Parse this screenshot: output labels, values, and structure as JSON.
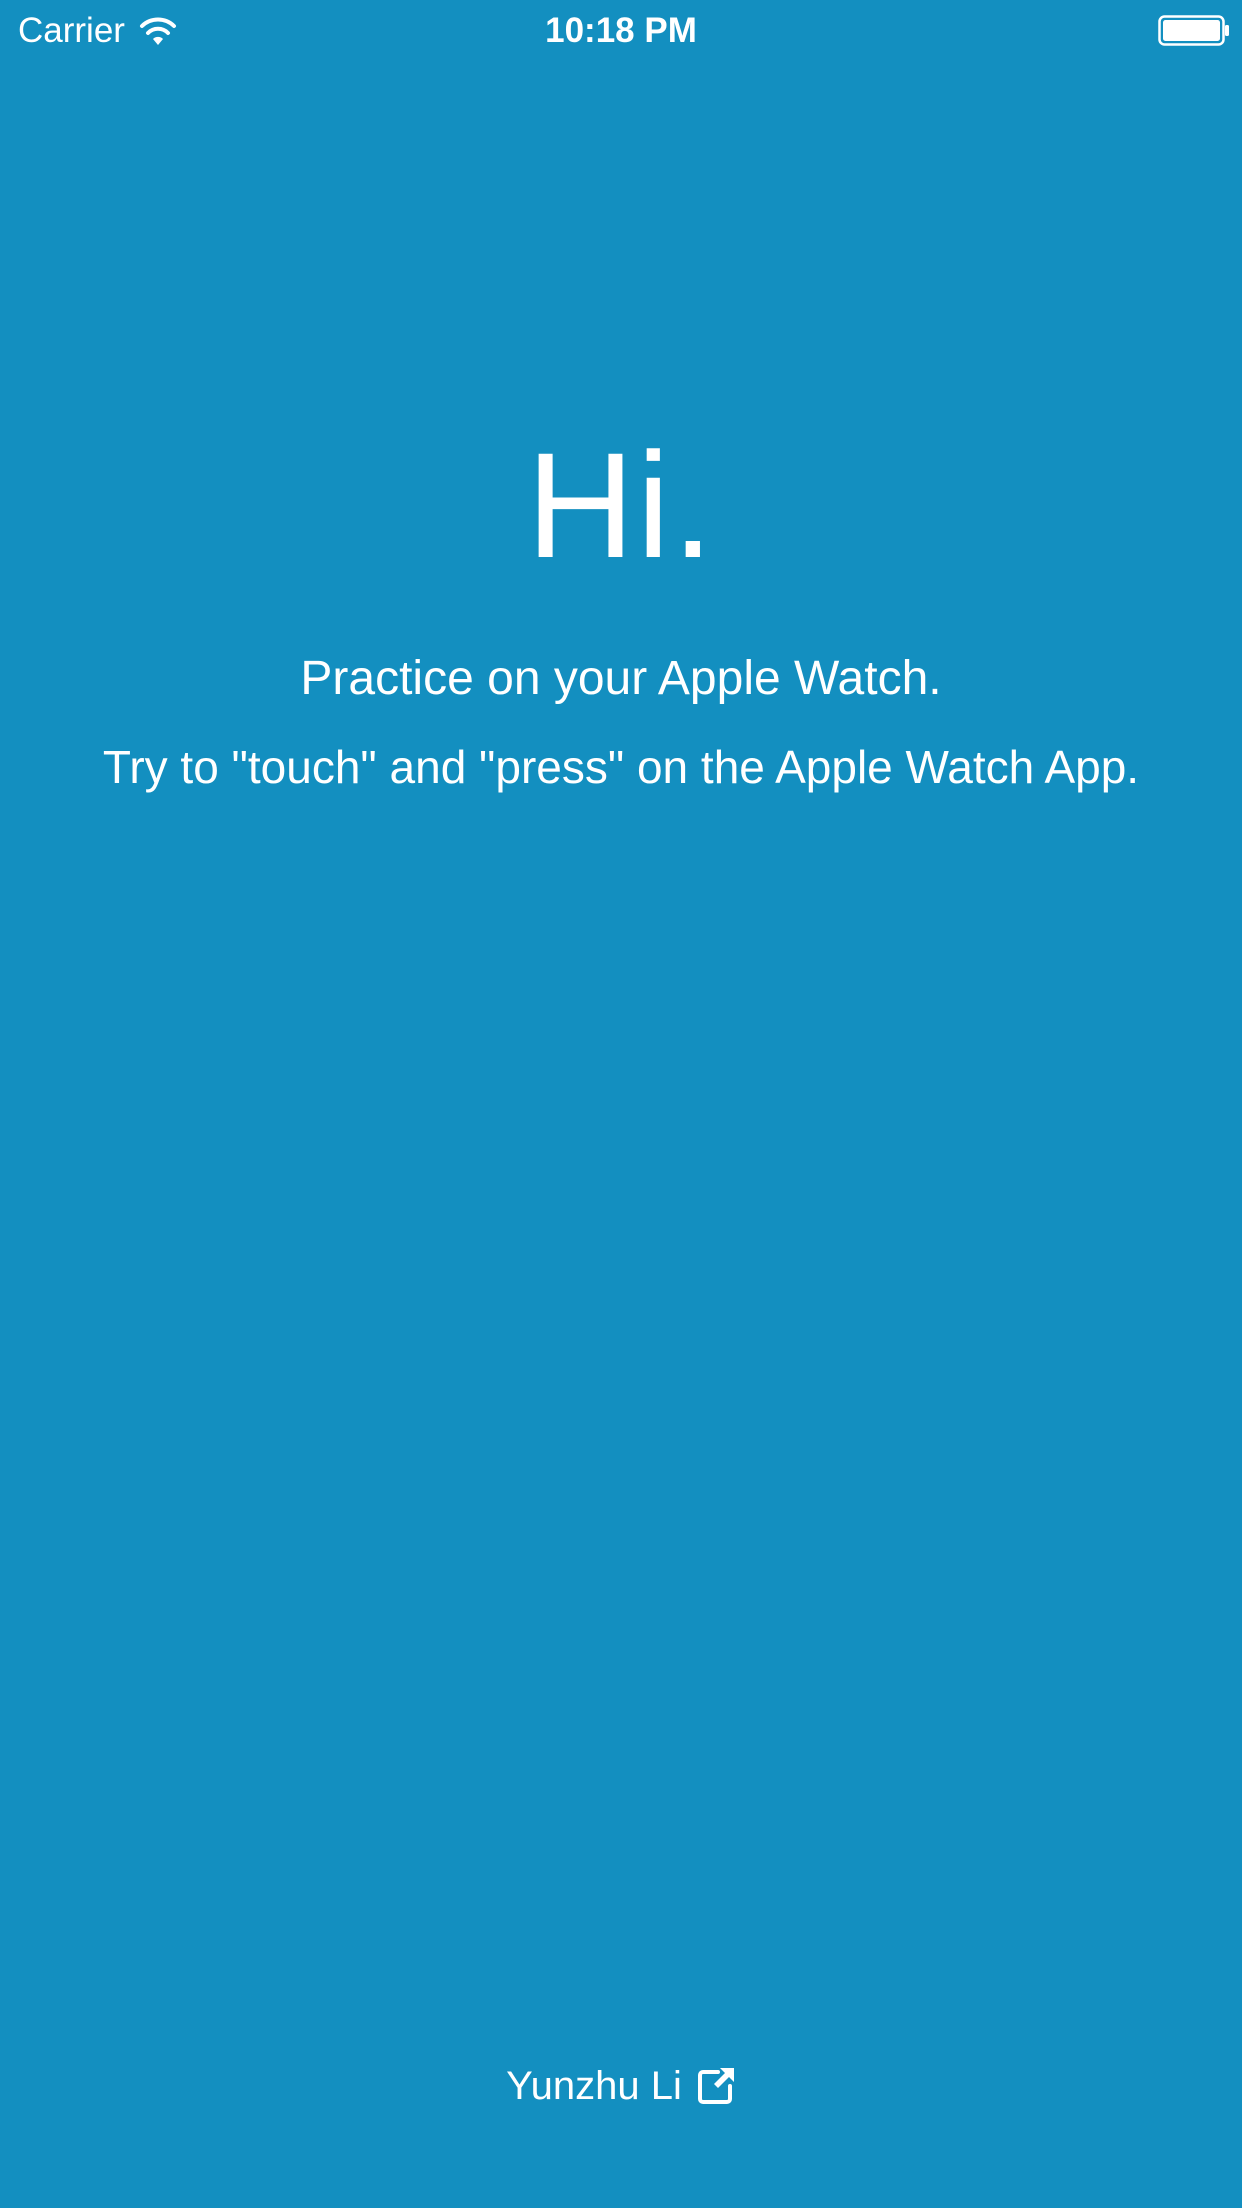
{
  "status_bar": {
    "carrier": "Carrier",
    "time": "10:18 PM",
    "wifi_icon": "wifi-icon",
    "battery_icon": "battery-icon"
  },
  "main": {
    "greeting": "Hi.",
    "line1": "Practice on your Apple Watch.",
    "line2": "Try to \"touch\" and \"press\" on the Apple Watch App."
  },
  "footer": {
    "author": "Yunzhu Li",
    "link_icon": "external-link-icon"
  },
  "colors": {
    "background": "#138FC0",
    "text": "#FFFFFF"
  }
}
